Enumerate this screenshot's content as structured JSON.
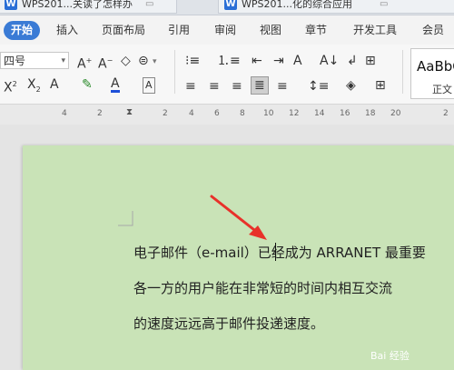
{
  "tabs": [
    {
      "title": "WPS201...关读了怎样办"
    },
    {
      "title": "WPS201...化的综合应用"
    }
  ],
  "menu": [
    "开始",
    "插入",
    "页面布局",
    "引用",
    "审阅",
    "视图",
    "章节",
    "开发工具",
    "会员专"
  ],
  "toolbar": {
    "font_size": "四号",
    "style_preview": "AaBbC",
    "style_name": "正文"
  },
  "ruler": [
    "4",
    "2",
    "2",
    "4",
    "6",
    "8",
    "10",
    "12",
    "14",
    "16",
    "18",
    "20",
    "2"
  ],
  "document": {
    "lines": [
      "电子邮件（e-mail）已经成为 ARRANET 最重要",
      "各一方的用户能在非常短的时间内相互交流",
      "的速度远远高于邮件投递速度。"
    ]
  },
  "watermark": "Bai 经验",
  "colors": {
    "accent": "#3a7bd5",
    "page_bg": "#c9e3b7",
    "arrow": "#e8312a"
  }
}
